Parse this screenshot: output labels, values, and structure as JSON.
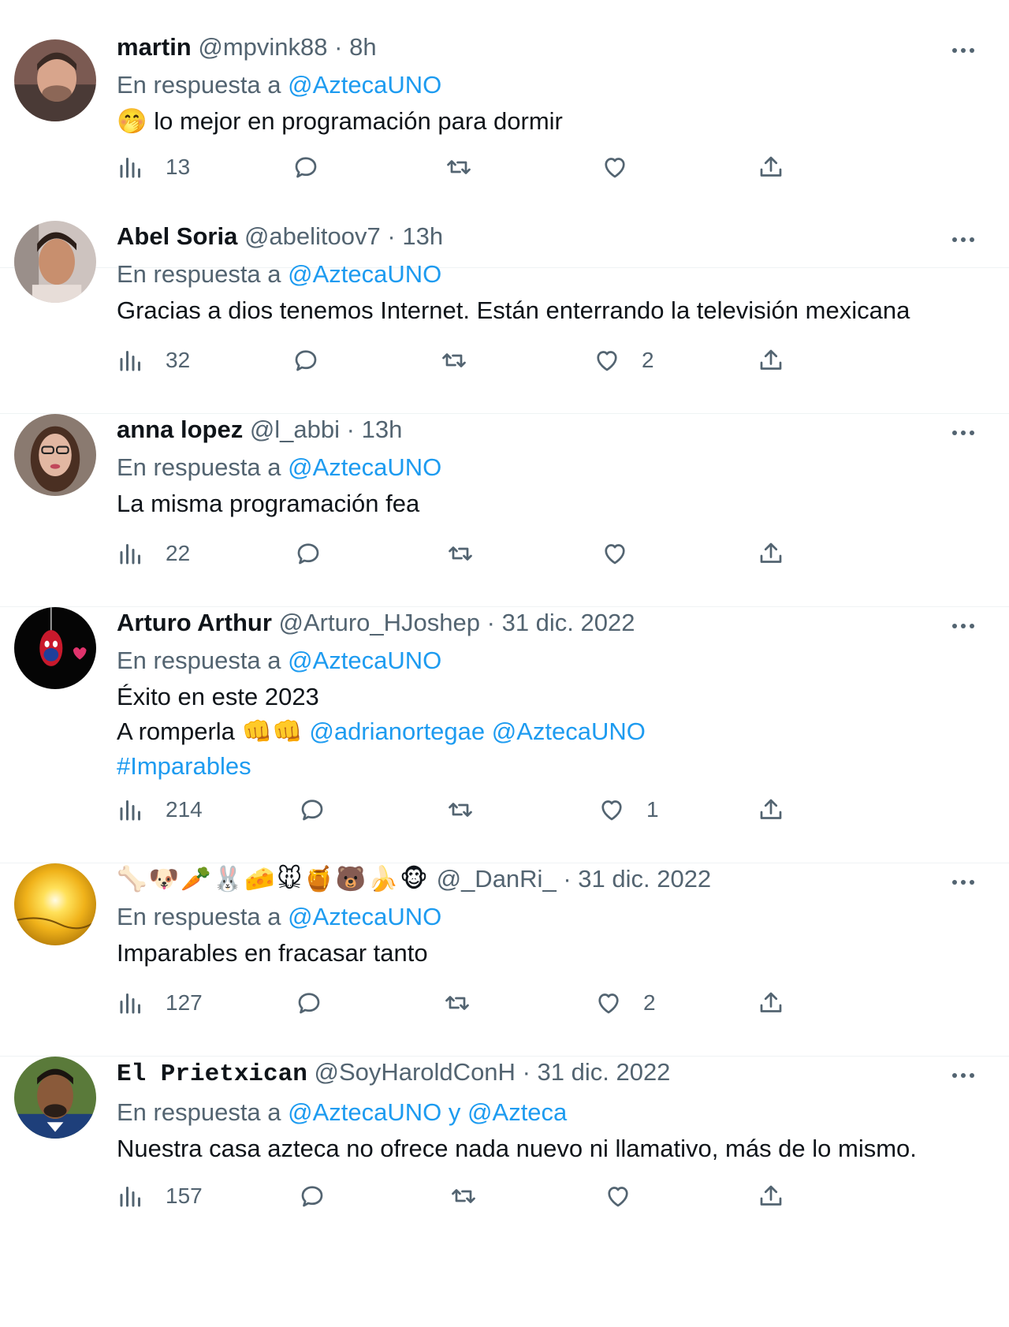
{
  "reply_prefix": "En respuesta a",
  "tweets": [
    {
      "name": "martin",
      "handle": "@mpvink88",
      "time": "8h",
      "reply_to": "@AztecaUNO",
      "text_emoji": "🤭",
      "text": "lo mejor en programación para dormir",
      "views": "13",
      "likes": ""
    },
    {
      "name": "Abel Soria",
      "handle": "@abelitoov7",
      "time": "13h",
      "reply_to": "@AztecaUNO",
      "text": "Gracias a dios tenemos Internet. Están enterrando la televisión mexicana",
      "views": "32",
      "likes": "2"
    },
    {
      "name": "anna lopez",
      "handle": "@l_abbi",
      "time": "13h",
      "reply_to": "@AztecaUNO",
      "text": "La misma programación fea",
      "views": "22",
      "likes": ""
    },
    {
      "name": "Arturo Arthur",
      "handle": "@Arturo_HJoshep",
      "time": "31 dic. 2022",
      "reply_to": "@AztecaUNO",
      "text_line1": "Éxito en este 2023",
      "text_line2_prefix": "A romperla",
      "text_line2_emojis": "👊👊",
      "mention1": "@adrianortegae",
      "mention2": "@AztecaUNO",
      "hashtag": "#Imparables",
      "views": "214",
      "likes": "1"
    },
    {
      "name_emojis": "🦴🐶🥕🐰🧀🐭🍯🐻🍌🐵",
      "handle": "@_DanRi_",
      "time": "31 dic. 2022",
      "reply_to": "@AztecaUNO",
      "text": "Imparables en fracasar tanto",
      "views": "127",
      "likes": "2"
    },
    {
      "name": "El Prietxican",
      "handle": "@SoyHaroldConH",
      "time": "31 dic. 2022",
      "reply_to_1": "@AztecaUNO",
      "reply_joiner": "y",
      "reply_to_2": "@Azteca",
      "text": "Nuestra casa azteca no ofrece nada nuevo ni llamativo, más de lo mismo.",
      "views": "157",
      "likes": ""
    }
  ],
  "colors": {
    "text": "#0f1419",
    "secondary": "#536471",
    "link": "#1d9bf0",
    "divider": "#eff3f4"
  },
  "icons": [
    "views-icon",
    "reply-icon",
    "retweet-icon",
    "like-icon",
    "share-icon",
    "more-icon"
  ]
}
